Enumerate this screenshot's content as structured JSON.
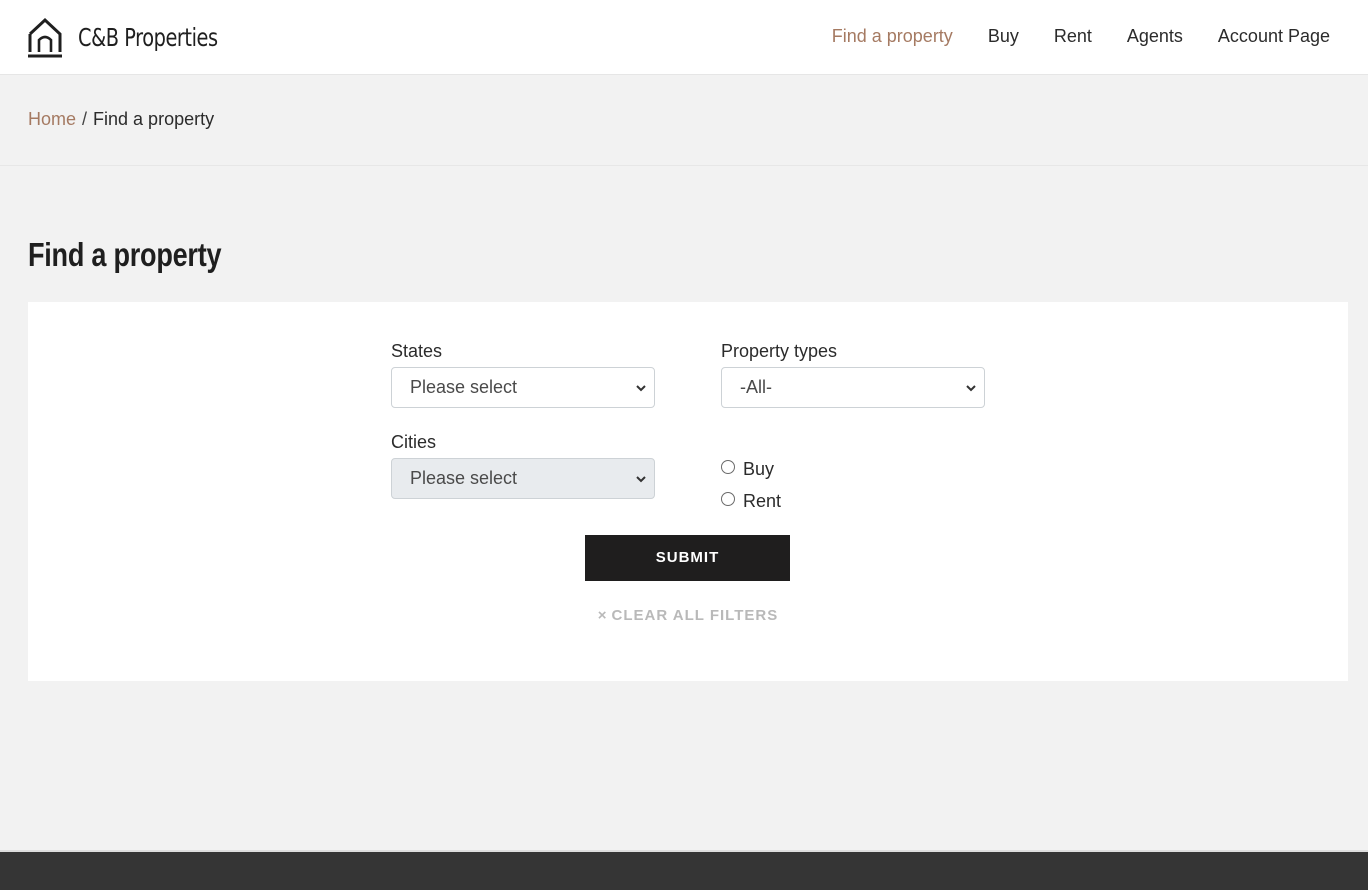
{
  "brand": {
    "name": "C&B Properties",
    "logo_icon": "house-outline-icon"
  },
  "nav": {
    "items": [
      {
        "label": "Find a property",
        "active": true
      },
      {
        "label": "Buy"
      },
      {
        "label": "Rent"
      },
      {
        "label": "Agents"
      },
      {
        "label": "Account Page"
      }
    ],
    "accent_color": "#a57a62"
  },
  "breadcrumb": {
    "home": "Home",
    "separator": "/",
    "current": "Find a property"
  },
  "page": {
    "title": "Find a property"
  },
  "filters": {
    "states": {
      "label": "States",
      "selected": "Please select"
    },
    "property_types": {
      "label": "Property types",
      "selected": "-All-"
    },
    "cities": {
      "label": "Cities",
      "selected": "Please select",
      "disabled": true
    },
    "listing_type": {
      "options": [
        {
          "label": "Buy",
          "checked": false
        },
        {
          "label": "Rent",
          "checked": false
        }
      ]
    },
    "submit_label": "SUBMIT",
    "clear_label": "CLEAR ALL FILTERS",
    "clear_icon": "×"
  },
  "colors": {
    "button_bg": "#1f1e1e",
    "footer_bg": "#353535",
    "page_bg": "#f2f2f2"
  }
}
